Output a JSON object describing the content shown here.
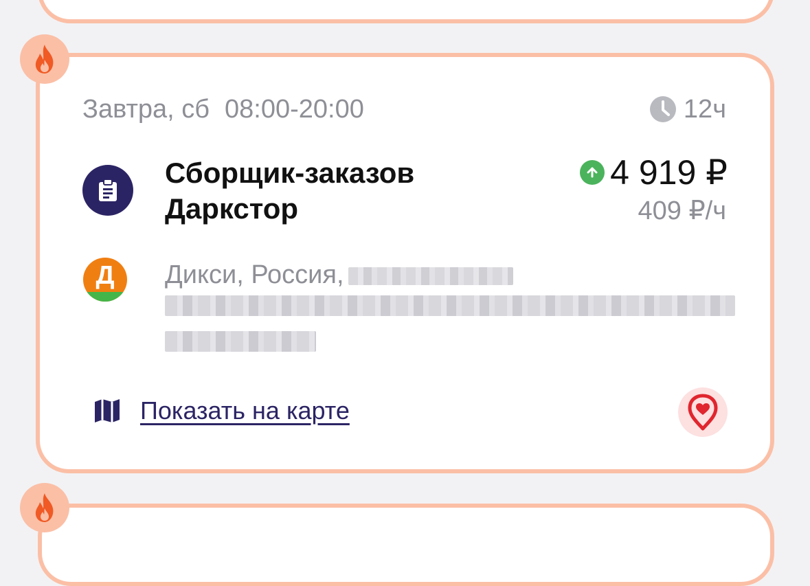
{
  "shift": {
    "date": "Завтра, сб",
    "time_range": "08:00-20:00",
    "duration": "12ч",
    "job_title": "Сборщик-заказов Даркстор",
    "pay_total": "4 919 ₽",
    "pay_rate": "409 ₽/ч",
    "store_logo_letter": "Д",
    "address_visible": "Дикси, Россия,",
    "map_link": "Показать на карте"
  },
  "icons": {
    "hot": "fire-icon",
    "duration": "clock-icon",
    "job": "clipboard-icon",
    "pay_trend": "arrow-up-icon",
    "store": "dixy-logo",
    "map": "map-icon",
    "favorite": "heart-pin-icon"
  },
  "colors": {
    "card_border": "#fbbfa6",
    "brand_navy": "#2b2464",
    "muted_text": "#8e8f96",
    "fire": "#f05a24",
    "pay_up": "#4bb35c",
    "favorite_red": "#e0262e",
    "favorite_bg": "#fde0e0"
  }
}
